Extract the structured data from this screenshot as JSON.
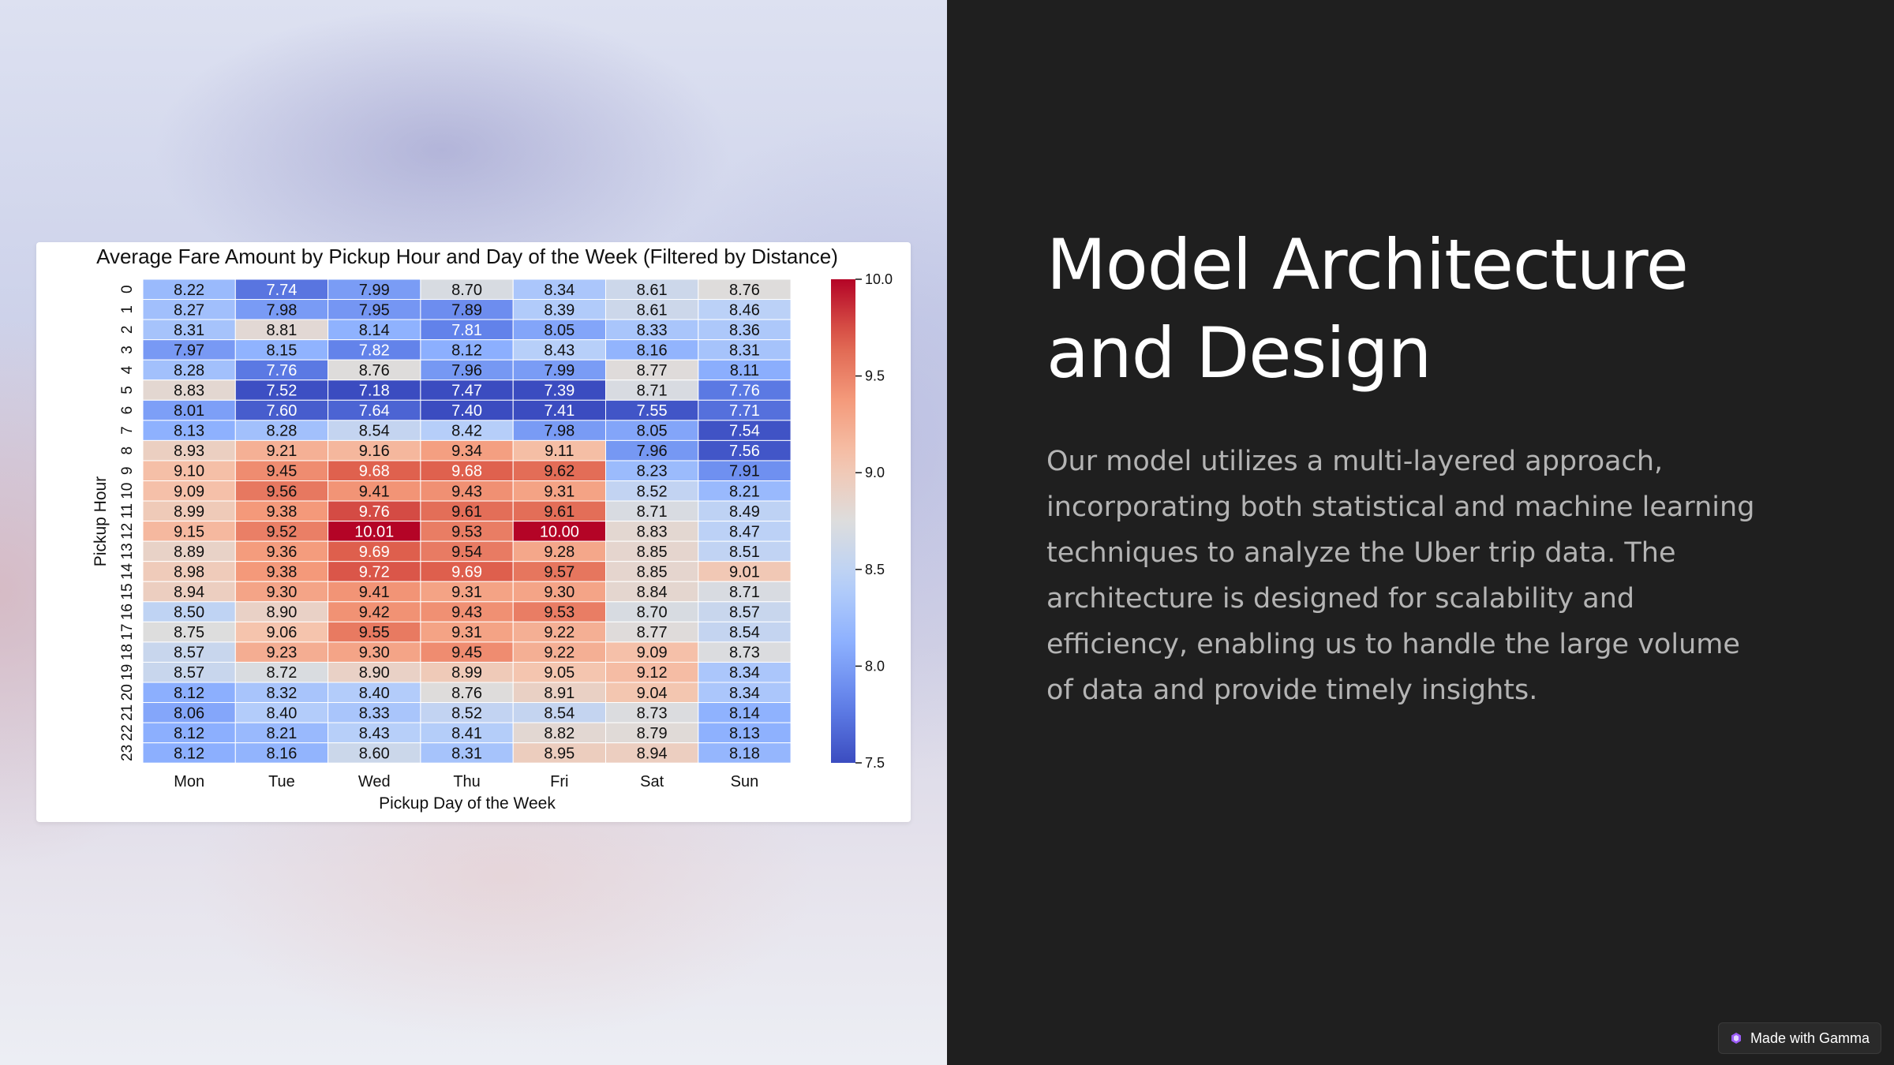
{
  "slide": {
    "title": "Model Architecture and Design",
    "body": "Our model utilizes a multi-layered approach, incorporating both statistical and machine learning techniques to analyze the Uber trip data. The architecture is designed for scalability and efficiency, enabling us to handle the large volume of data and provide timely insights.",
    "badge_label": "Made with Gamma",
    "badge_icon": "gamma-logo-icon"
  },
  "colors": {
    "right_background": "#1f1f1f",
    "title_color": "#ffffff",
    "body_color": "#b4b4b4",
    "colormap": "coolwarm"
  },
  "chart_data": {
    "type": "heatmap",
    "title": "Average Fare Amount by Pickup Hour and Day of the Week (Filtered by Distance)",
    "xlabel": "Pickup Day of the Week",
    "ylabel": "Pickup Hour",
    "x": [
      "Mon",
      "Tue",
      "Wed",
      "Thu",
      "Fri",
      "Sat",
      "Sun"
    ],
    "y": [
      "0",
      "1",
      "2",
      "3",
      "4",
      "5",
      "6",
      "7",
      "8",
      "9",
      "10",
      "11",
      "12",
      "13",
      "14",
      "15",
      "16",
      "17",
      "18",
      "19",
      "20",
      "21",
      "22",
      "23"
    ],
    "values": [
      [
        8.22,
        7.74,
        7.99,
        8.7,
        8.34,
        8.61,
        8.76
      ],
      [
        8.27,
        7.98,
        7.95,
        7.89,
        8.39,
        8.61,
        8.46
      ],
      [
        8.31,
        8.81,
        8.14,
        7.81,
        8.05,
        8.33,
        8.36
      ],
      [
        7.97,
        8.15,
        7.82,
        8.12,
        8.43,
        8.16,
        8.31
      ],
      [
        8.28,
        7.76,
        8.76,
        7.96,
        7.99,
        8.77,
        8.11
      ],
      [
        8.83,
        7.52,
        7.18,
        7.47,
        7.39,
        8.71,
        7.76
      ],
      [
        8.01,
        7.6,
        7.64,
        7.4,
        7.41,
        7.55,
        7.71
      ],
      [
        8.13,
        8.28,
        8.54,
        8.42,
        7.98,
        8.05,
        7.54
      ],
      [
        8.93,
        9.21,
        9.16,
        9.34,
        9.11,
        7.96,
        7.56
      ],
      [
        9.1,
        9.45,
        9.68,
        9.68,
        9.62,
        8.23,
        7.91
      ],
      [
        9.09,
        9.56,
        9.41,
        9.43,
        9.31,
        8.52,
        8.21
      ],
      [
        8.99,
        9.38,
        9.76,
        9.61,
        9.61,
        8.71,
        8.49
      ],
      [
        9.15,
        9.52,
        10.01,
        9.53,
        10.0,
        8.83,
        8.47
      ],
      [
        8.89,
        9.36,
        9.69,
        9.54,
        9.28,
        8.85,
        8.51
      ],
      [
        8.98,
        9.38,
        9.72,
        9.69,
        9.57,
        8.85,
        9.01
      ],
      [
        8.94,
        9.3,
        9.41,
        9.31,
        9.3,
        8.84,
        8.71
      ],
      [
        8.5,
        8.9,
        9.42,
        9.43,
        9.53,
        8.7,
        8.57
      ],
      [
        8.75,
        9.06,
        9.55,
        9.31,
        9.22,
        8.77,
        8.54
      ],
      [
        8.57,
        9.23,
        9.3,
        9.45,
        9.22,
        9.09,
        8.73
      ],
      [
        8.57,
        8.72,
        8.9,
        8.99,
        9.05,
        9.12,
        8.34
      ],
      [
        8.12,
        8.32,
        8.4,
        8.76,
        8.91,
        9.04,
        8.34
      ],
      [
        8.06,
        8.4,
        8.33,
        8.52,
        8.54,
        8.73,
        8.14
      ],
      [
        8.12,
        8.21,
        8.43,
        8.41,
        8.82,
        8.79,
        8.13
      ],
      [
        8.12,
        8.16,
        8.6,
        8.31,
        8.95,
        8.94,
        8.18
      ]
    ],
    "colorbar": {
      "min": 7.5,
      "max": 10.0,
      "ticks": [
        "7.5",
        "8.0",
        "8.5",
        "9.0",
        "9.5",
        "10.0"
      ]
    },
    "annotated": true,
    "grid": false
  }
}
